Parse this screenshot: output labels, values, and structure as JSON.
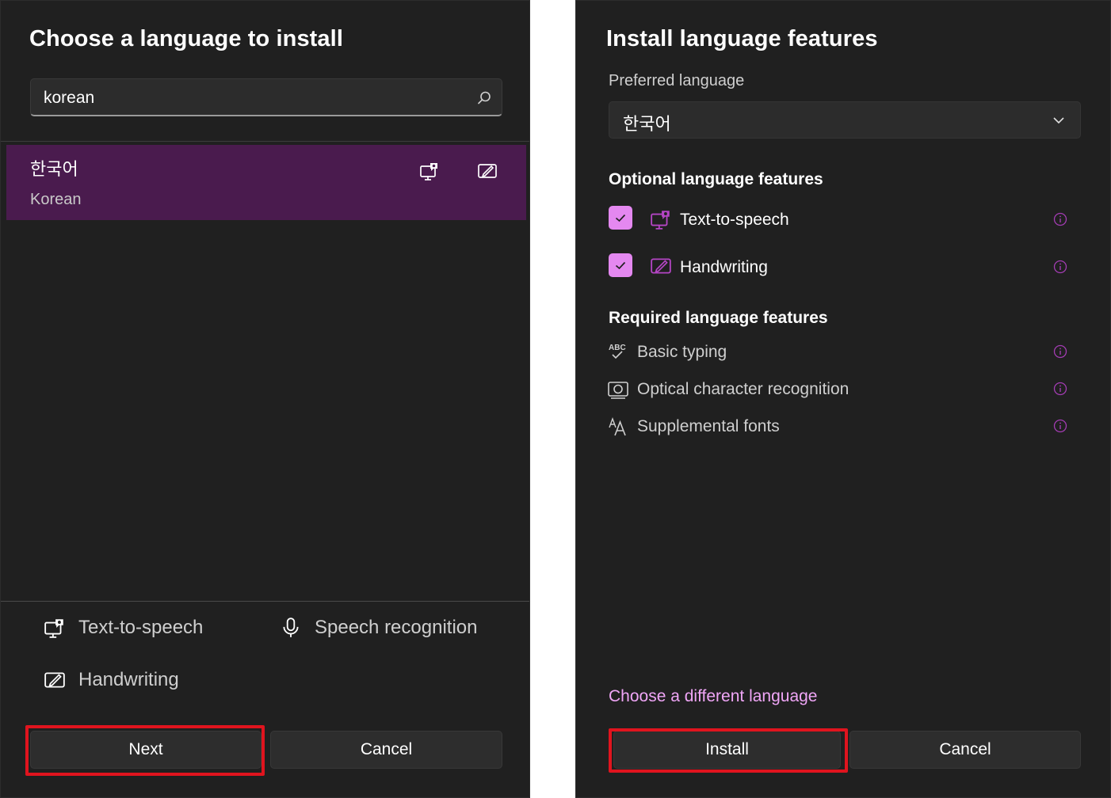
{
  "left": {
    "title": "Choose a language to install",
    "search": {
      "value": "korean"
    },
    "result": {
      "native": "한국어",
      "english": "Korean"
    },
    "features": {
      "tts": "Text-to-speech",
      "speech": "Speech recognition",
      "handwriting": "Handwriting"
    },
    "buttons": {
      "next": "Next",
      "cancel": "Cancel"
    }
  },
  "right": {
    "title": "Install language features",
    "preferred_label": "Preferred language",
    "preferred_value": "한국어",
    "optional_heading": "Optional language features",
    "optional": [
      {
        "label": "Text-to-speech",
        "checked": true
      },
      {
        "label": "Handwriting",
        "checked": true
      }
    ],
    "required_heading": "Required language features",
    "required": [
      {
        "label": "Basic typing"
      },
      {
        "label": "Optical character recognition"
      },
      {
        "label": "Supplemental fonts"
      }
    ],
    "link": "Choose a different language",
    "buttons": {
      "install": "Install",
      "cancel": "Cancel"
    }
  },
  "colors": {
    "accent": "#e488f0",
    "selection": "#4a1b4e",
    "highlight": "#e0141e",
    "link": "#f0a6f7",
    "icon_accent": "#b445c4"
  }
}
